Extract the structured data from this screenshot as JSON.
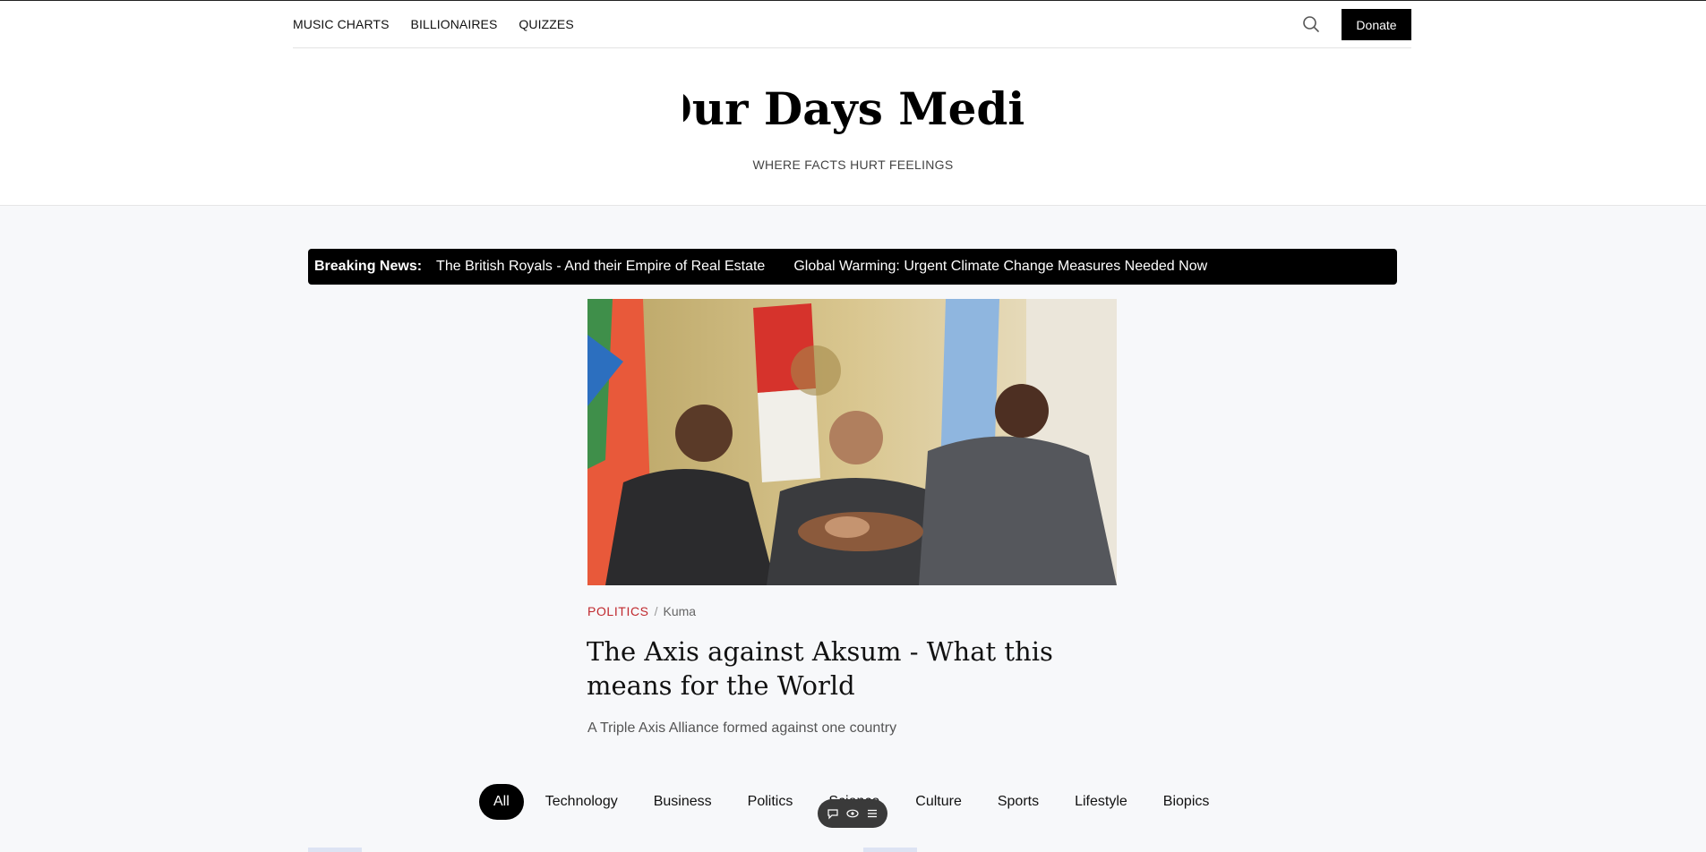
{
  "topnav": {
    "items": [
      {
        "label": "MUSIC CHARTS"
      },
      {
        "label": "BILLIONAIRES"
      },
      {
        "label": "QUIZZES"
      }
    ]
  },
  "header": {
    "donate_label": "Donate",
    "site_title": "Our Days Media",
    "tagline": "WHERE FACTS HURT FEELINGS"
  },
  "breaking": {
    "label": "Breaking News:",
    "items": [
      {
        "text": "The British Royals - And their Empire of Real Estate"
      },
      {
        "text": "Global Warming: Urgent Climate Change Measures Needed Now"
      }
    ]
  },
  "featured": {
    "category": "POLITICS",
    "separator": "/",
    "author": "Kuma",
    "title": "The Axis against Aksum - What this means for the World",
    "dek": "A Triple Axis Alliance formed against one country"
  },
  "filters": [
    {
      "label": "All"
    },
    {
      "label": "Technology"
    },
    {
      "label": "Business"
    },
    {
      "label": "Politics"
    },
    {
      "label": "Science"
    },
    {
      "label": "Culture"
    },
    {
      "label": "Sports"
    },
    {
      "label": "Lifestyle"
    },
    {
      "label": "Biopics"
    }
  ],
  "colors": {
    "accent": "#c0282d",
    "breaking_bg": "#000000",
    "page_bg": "#f7f8fa"
  },
  "icons": {
    "search": "search-icon",
    "toolbar": [
      "comment-icon",
      "eye-icon",
      "menu-icon"
    ]
  }
}
